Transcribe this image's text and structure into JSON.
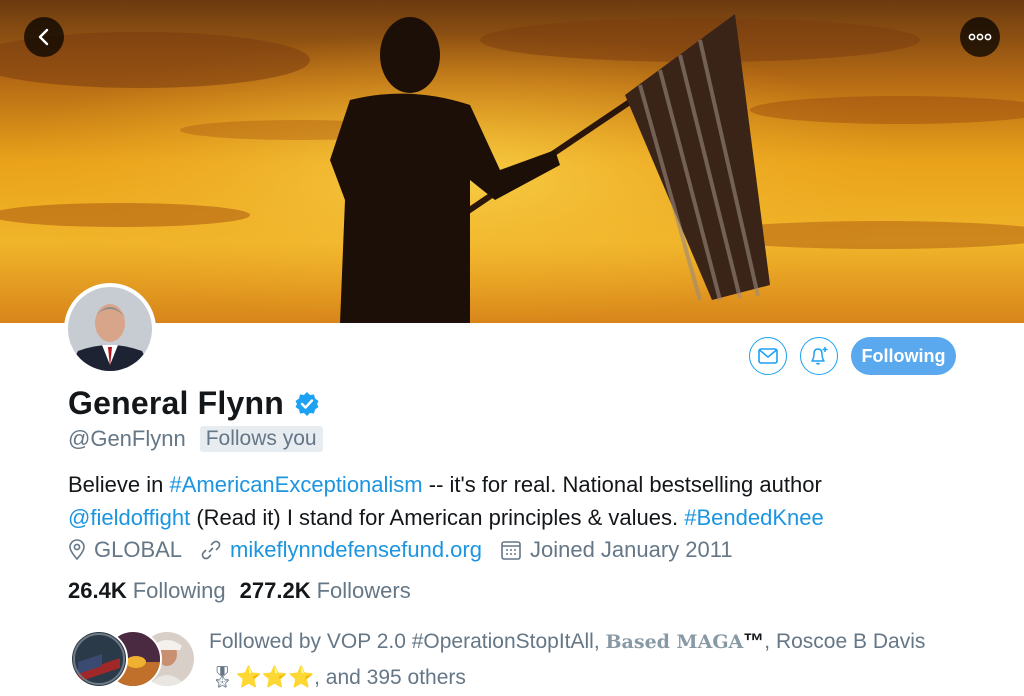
{
  "header": {
    "back_icon": "chevron-left-icon",
    "more_icon": "more-horizontal-icon",
    "banner_description_colors": {
      "sky_top": "#6b3a10",
      "sky_mid": "#e39a12",
      "sky_glow": "#f5c53a"
    }
  },
  "profile": {
    "display_name": "General Flynn",
    "verified_icon": "verified-badge-icon",
    "handle": "@GenFlynn",
    "follows_you": "Follows you",
    "bio": {
      "line1_text": "Believe in ",
      "line1_hashtag": "#AmericanExceptionalism",
      "line1_rest": " -- it's for real. National bestselling author",
      "line2_mention": "@fieldoffight",
      "line2_text": " (Read it) I stand for American principles & values. ",
      "line2_hashtag": "#BendedKnee"
    },
    "location": "GLOBAL",
    "website": "mikeflynndefensefund.org",
    "joined": "Joined January 2011"
  },
  "actions": {
    "message_icon": "envelope-icon",
    "notify_icon": "bell-plus-icon",
    "following_label": "Following"
  },
  "stats": {
    "following_count": "26.4K",
    "following_label": "Following",
    "followers_count": "277.2K",
    "followers_label": "Followers"
  },
  "followed_by": {
    "prefix": "Followed by VOP 2.0 #OperationStopItAll, ",
    "based_name": "Based MAGA",
    "tm": "™",
    "after_based": ", Roscoe B Davis",
    "line2_emoji": "🎖⭐⭐⭐",
    "line2_rest": ", and 395 others"
  },
  "colors": {
    "accent": "#1da1f2",
    "link": "#1b95e0",
    "following_button": "#5aa8ee",
    "secondary_text": "#657786",
    "primary_text": "#14171a"
  }
}
